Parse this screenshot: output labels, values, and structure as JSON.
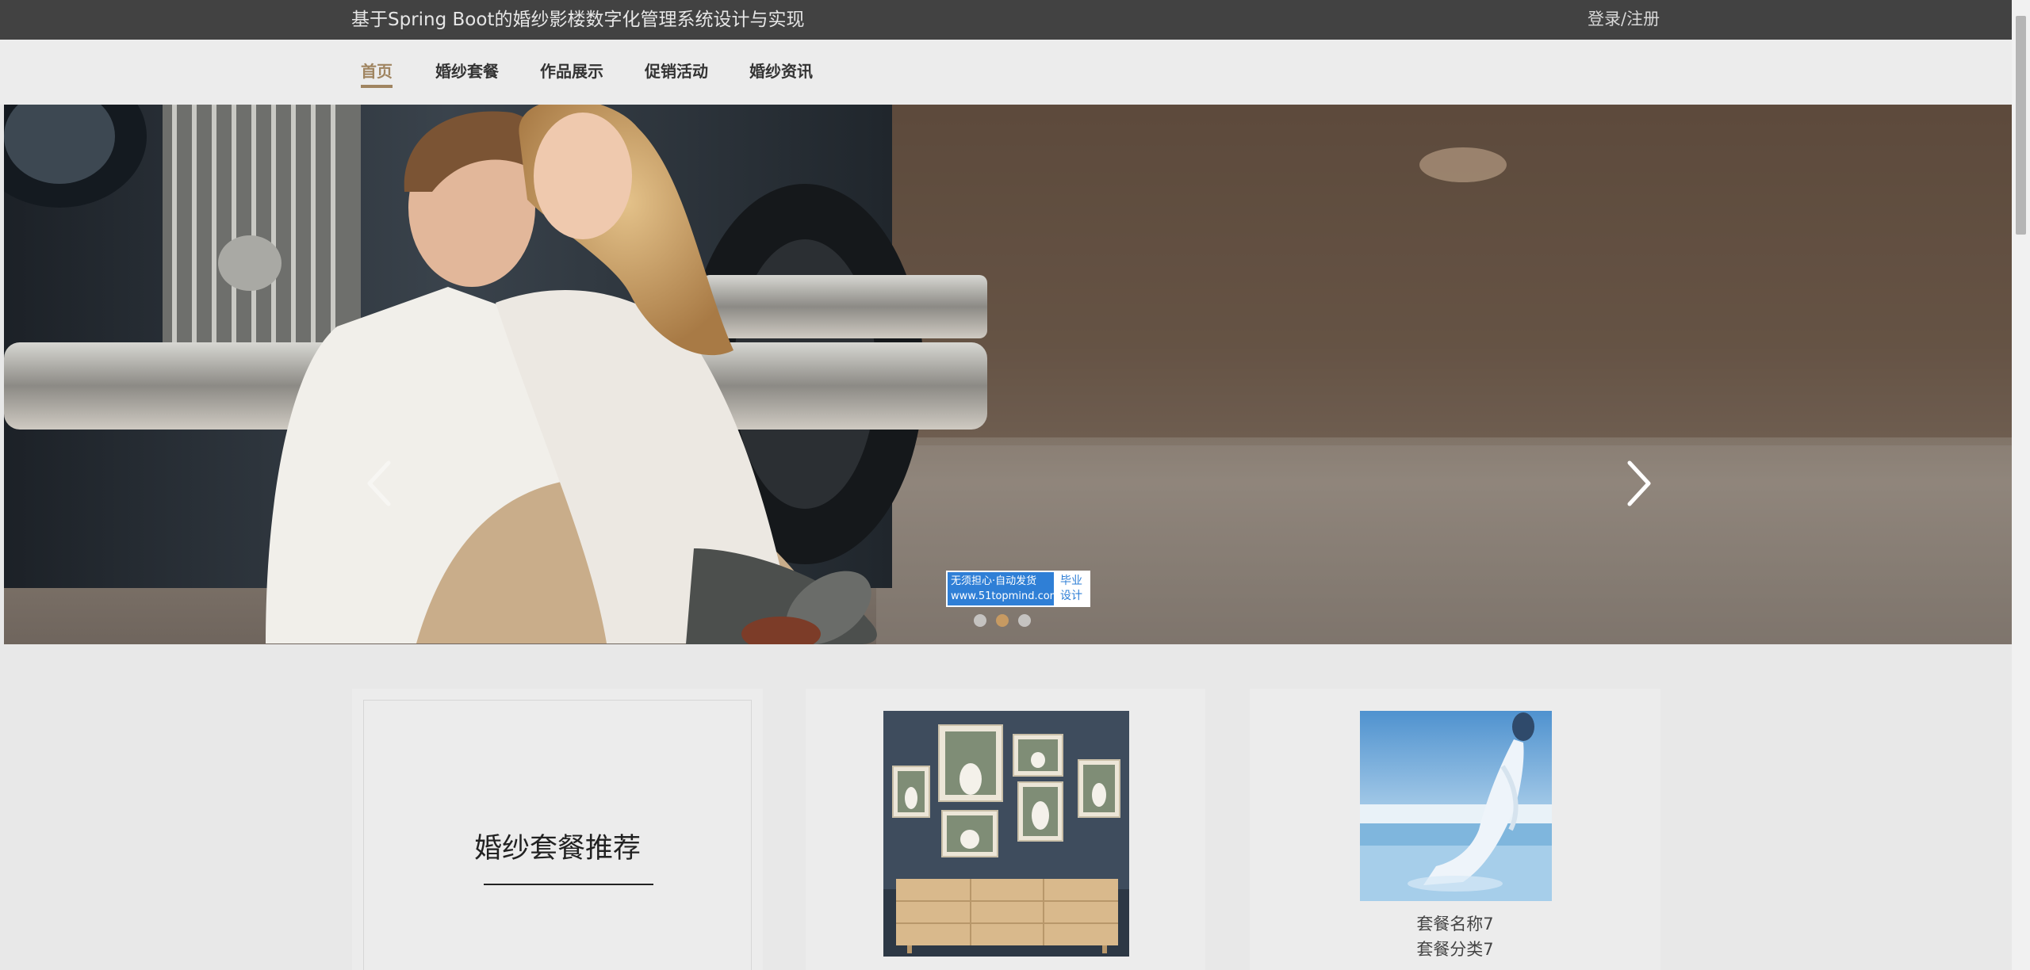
{
  "header": {
    "site_title": "基于Spring Boot的婚纱影楼数字化管理系统设计与实现",
    "login_label": "登录/注册"
  },
  "nav": {
    "items": [
      {
        "label": "首页",
        "active": true
      },
      {
        "label": "婚纱套餐",
        "active": false
      },
      {
        "label": "作品展示",
        "active": false
      },
      {
        "label": "促销活动",
        "active": false
      },
      {
        "label": "婚纱资讯",
        "active": false
      }
    ]
  },
  "banner": {
    "prev_icon": "chevron-left-icon",
    "next_icon": "chevron-right-icon",
    "slide_count": 3,
    "active_slide": 2,
    "watermark": {
      "line1": "无须担心·自动发货",
      "line2": "www.51topmind.com",
      "badge_line1": "毕业",
      "badge_line2": "设计"
    }
  },
  "recommend": {
    "section_title": "婚纱套餐推荐",
    "packages": [
      {
        "name": "",
        "category": ""
      },
      {
        "name": "套餐名称7",
        "category": "套餐分类7"
      }
    ]
  },
  "colors": {
    "topbar_bg": "#424242",
    "accent": "#a08561",
    "page_bg": "#e8e8e8"
  }
}
